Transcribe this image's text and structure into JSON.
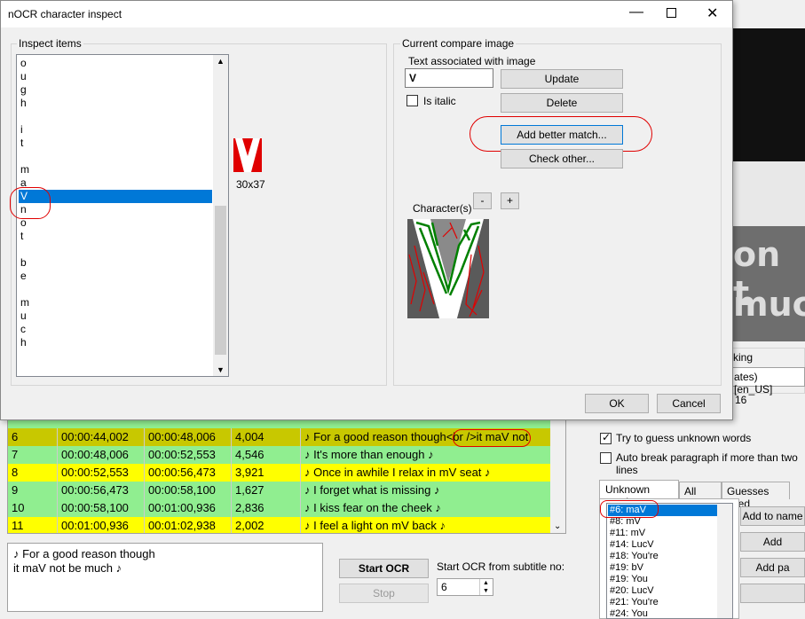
{
  "dialog": {
    "title": "nOCR character inspect",
    "inspect_label": "Inspect items",
    "items": [
      "o",
      "u",
      "g",
      "h",
      "",
      "i",
      "t",
      "",
      "m",
      "a",
      "V",
      "n",
      "o",
      "t",
      "",
      "b",
      "e",
      "",
      "m",
      "u",
      "c",
      "h"
    ],
    "selected_index": 10,
    "preview_size": "30x37",
    "compare_label": "Current compare image",
    "text_assoc_label": "Text associated with image",
    "text_value": "V",
    "is_italic_label": "Is italic",
    "update_label": "Update",
    "delete_label": "Delete",
    "add_better_label": "Add better match...",
    "check_other_label": "Check other...",
    "characters_label": "Character(s)",
    "minus_label": "-",
    "plus_label": "+",
    "ok_label": "OK",
    "cancel_label": "Cancel"
  },
  "grid": {
    "rows": [
      {
        "num": "6",
        "start": "00:00:44,002",
        "end": "00:00:48,006",
        "dur": "4,004",
        "text": "♪ For a good reason though<br />it maV not",
        "style": "sel"
      },
      {
        "num": "7",
        "start": "00:00:48,006",
        "end": "00:00:52,553",
        "dur": "4,546",
        "text": "♪ It's more than enough ♪",
        "style": "green"
      },
      {
        "num": "8",
        "start": "00:00:52,553",
        "end": "00:00:56,473",
        "dur": "3,921",
        "text": "♪ Once in awhile I relax in mV seat ♪",
        "style": "yellow"
      },
      {
        "num": "9",
        "start": "00:00:56,473",
        "end": "00:00:58,100",
        "dur": "1,627",
        "text": "♪ I forget what is missing ♪",
        "style": "green"
      },
      {
        "num": "10",
        "start": "00:00:58,100",
        "end": "00:01:00,936",
        "dur": "2,836",
        "text": "♪ I kiss fear on the cheek ♪",
        "style": "green"
      },
      {
        "num": "11",
        "start": "00:01:00,936",
        "end": "00:01:02,938",
        "dur": "2,002",
        "text": "♪ I feel a light on mV back ♪",
        "style": "yellow"
      }
    ]
  },
  "textbox": {
    "line1": "♪ For a good reason though",
    "line2": "it maV not be much ♪"
  },
  "ocr": {
    "start_label": "Start OCR",
    "stop_label": "Stop",
    "from_label": "Start OCR from subtitle no:",
    "from_value": "6"
  },
  "right_panel": {
    "partial1": "king",
    "dict_value": "ates) [en_US]",
    "num16": "16",
    "guess_label": "Try to guess unknown words",
    "autobreak_label": "Auto break paragraph if more than two lines",
    "tabs": [
      "Unknown words",
      "All fixes",
      "Guesses used"
    ],
    "unknown_words": [
      "#6: maV",
      "#8: mV",
      "#11: mV",
      "#14: LucV",
      "#18: You're",
      "#19: bV",
      "#19: You",
      "#20: LucV",
      "#21: You're",
      "#24: You"
    ],
    "add_to_names": "Add to name",
    "add_label": "Add",
    "add_pair": "Add pa",
    "big_line1": "on t",
    "big_line2": "muc"
  }
}
